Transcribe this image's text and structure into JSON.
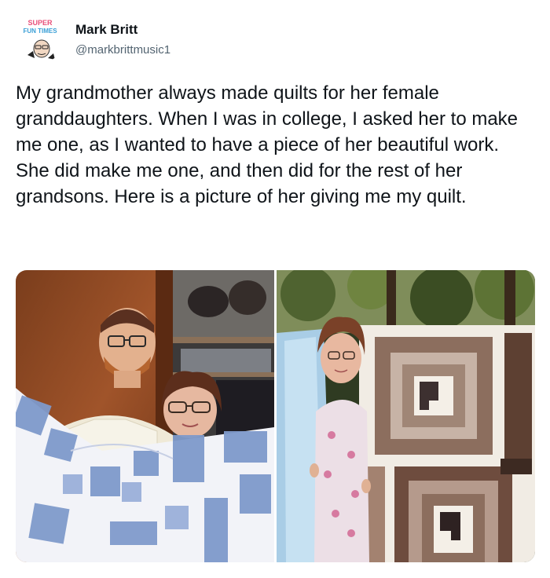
{
  "tweet": {
    "author": {
      "display_name": "Mark Britt",
      "handle": "@markbrittmusic1",
      "avatar_badge_lines": [
        "SUPER",
        "FUN TIMES"
      ],
      "avatar_icon": "cartoon-avatar-icon"
    },
    "text": "My grandmother always made quilts for her female granddaughters. When I was in college, I asked her to make me one, as I wanted to have a piece of her beautiful work. She did make me one, and then did for the rest of her grandsons. Here is a picture of her giving me my quilt.",
    "media": {
      "photos": [
        {
          "description_icon": "photo-icon"
        },
        {
          "description_icon": "photo-icon"
        }
      ]
    }
  },
  "colors": {
    "text_primary": "#0f1419",
    "text_secondary": "#536471",
    "background": "#ffffff"
  }
}
